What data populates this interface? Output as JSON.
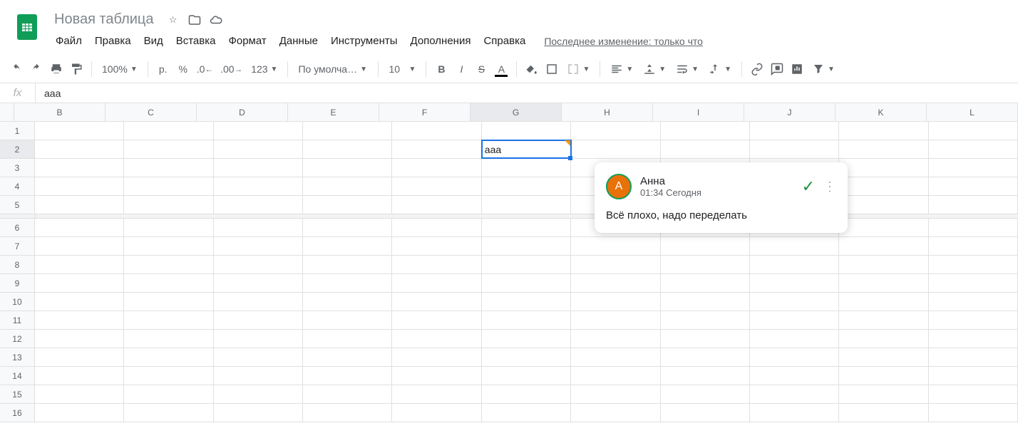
{
  "header": {
    "doc_title": "Новая таблица",
    "menus": [
      "Файл",
      "Правка",
      "Вид",
      "Вставка",
      "Формат",
      "Данные",
      "Инструменты",
      "Дополнения",
      "Справка"
    ],
    "last_edit": "Последнее изменение: только что"
  },
  "toolbar": {
    "zoom": "100%",
    "currency": "р.",
    "percent": "%",
    "dec_less": ".0",
    "dec_more": ".00",
    "num_format": "123",
    "font": "По умолча…",
    "font_size": "10",
    "bold": "B",
    "italic": "I",
    "strike": "S",
    "text_a": "A"
  },
  "formula_bar": {
    "fx": "fx",
    "content": "ааа"
  },
  "grid": {
    "columns": [
      "B",
      "C",
      "D",
      "E",
      "F",
      "G",
      "H",
      "I",
      "J",
      "K",
      "L"
    ],
    "rows": [
      "1",
      "2",
      "3",
      "4",
      "5",
      "6",
      "7",
      "8",
      "9",
      "10",
      "11",
      "12",
      "13",
      "14",
      "15",
      "16"
    ],
    "active_col_index": 5,
    "active_row_index": 1,
    "cells": {
      "G2": "ааа"
    }
  },
  "comment": {
    "avatar_initial": "А",
    "author": "Анна",
    "timestamp": "01:34 Сегодня",
    "body": "Всё плохо, надо переделать"
  }
}
